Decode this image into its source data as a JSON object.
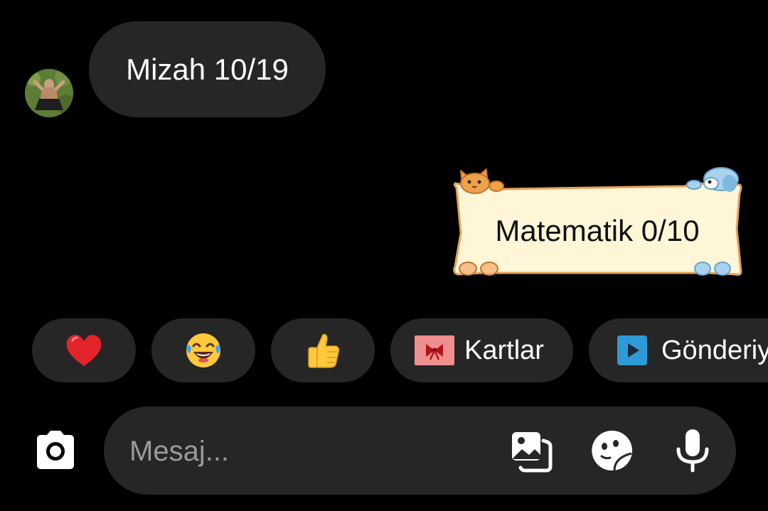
{
  "thread": {
    "incoming": {
      "text": "Mizah 10/19",
      "avatar": "profile-photo"
    },
    "outgoing": {
      "text": "Matematik 0/10",
      "frame_style": "cat-and-dog-banner"
    }
  },
  "quick_replies": {
    "heart": {
      "icon": "red-heart-icon"
    },
    "laugh": {
      "icon": "tears-of-joy-icon"
    },
    "thumbs_up": {
      "icon": "thumbs-up-icon"
    },
    "cards": {
      "label": "Kartlar",
      "icon": "gift-card-icon"
    },
    "send": {
      "label": "Gönderiyi",
      "icon": "play-icon"
    }
  },
  "composer": {
    "placeholder": "Mesaj...",
    "icons": [
      "camera-icon",
      "gallery-icon",
      "sticker-icon",
      "microphone-icon"
    ]
  },
  "colors": {
    "background": "#000000",
    "bubble": "#262626",
    "sticker_fill": "#fff6d8",
    "sticker_border": "#e2a25a",
    "card_icon": "#f08f8f",
    "play_icon": "#2f9bd6"
  }
}
